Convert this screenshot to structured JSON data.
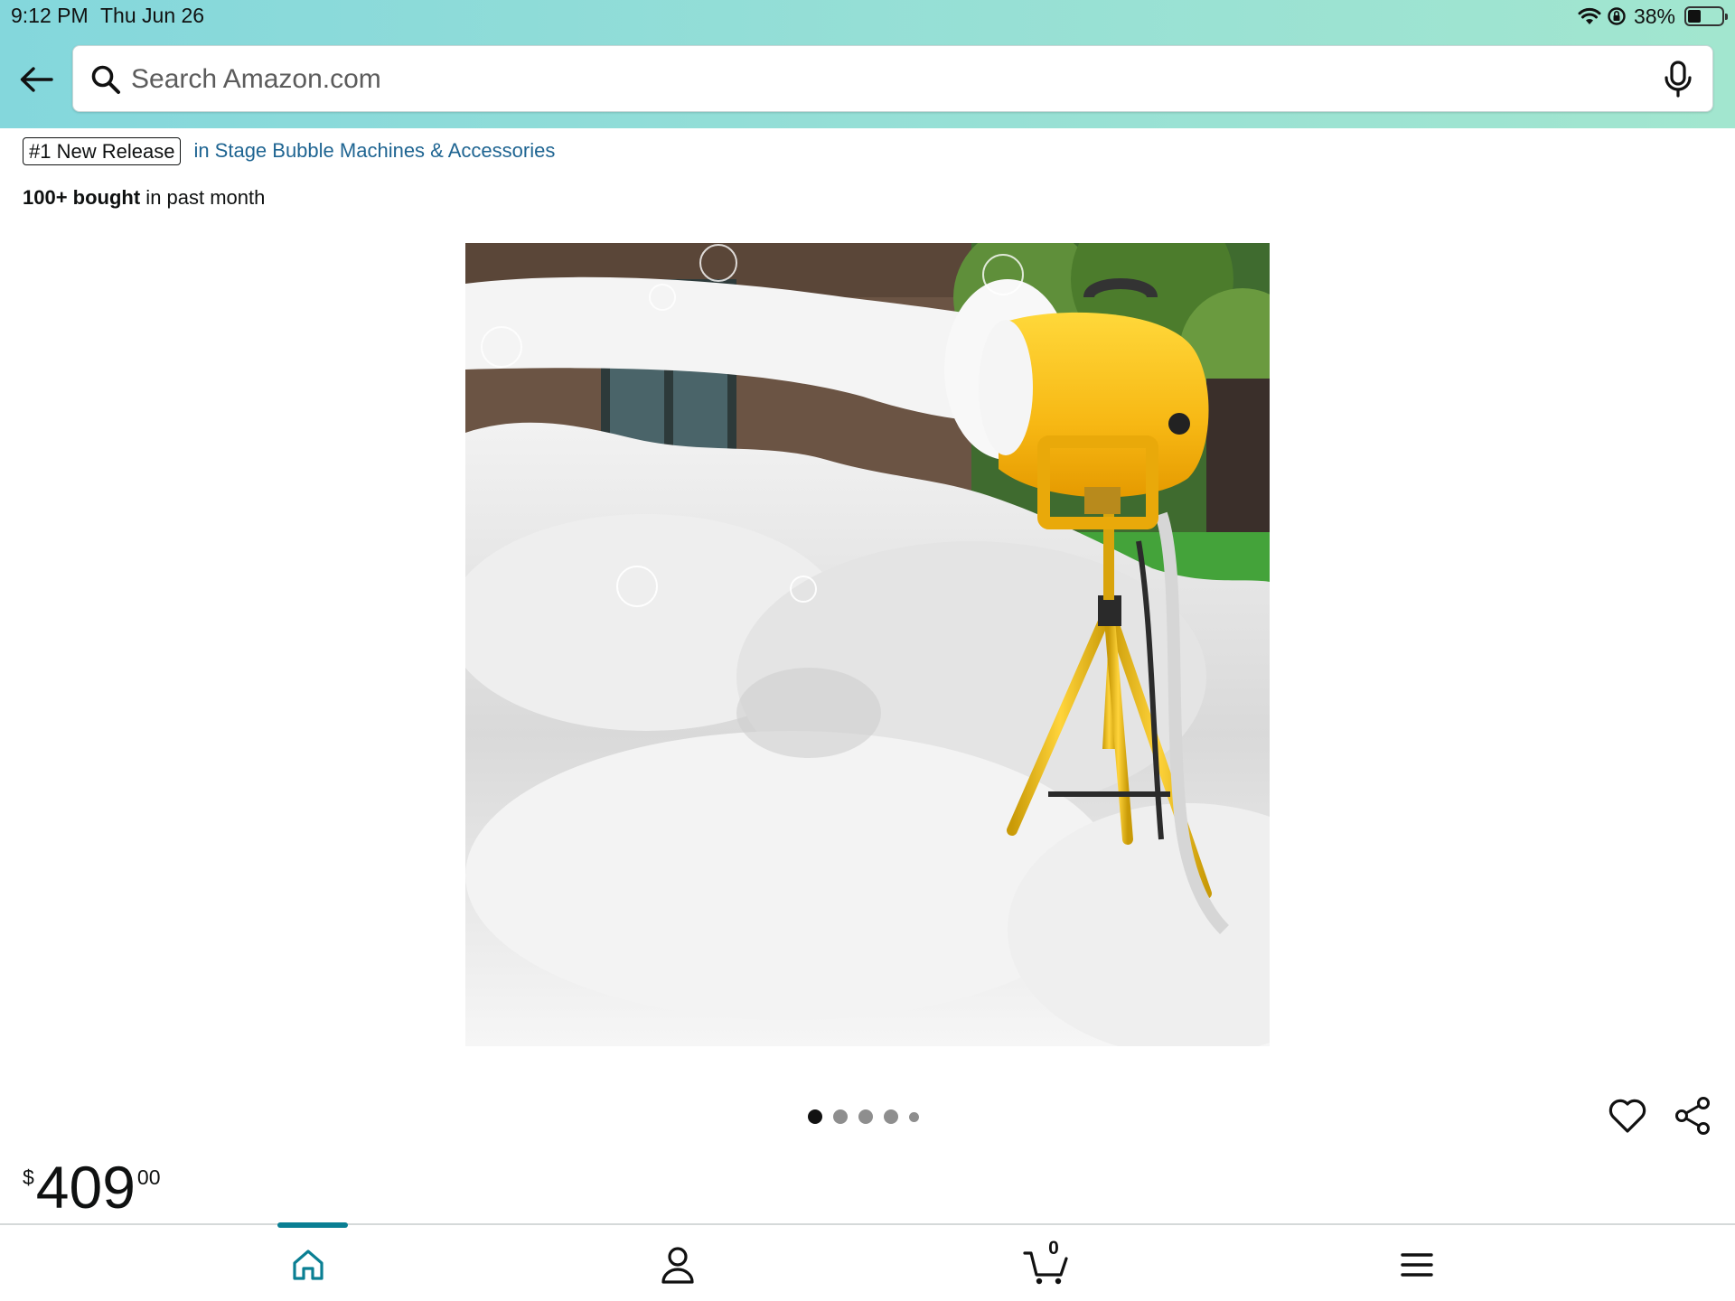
{
  "status_bar": {
    "time": "9:12 PM",
    "date": "Thu Jun 26",
    "battery_percent": "38%",
    "battery_level": 0.38,
    "icons": [
      "wifi-icon",
      "location-lock-icon",
      "battery-icon"
    ]
  },
  "header": {
    "back_icon": "arrow-left-icon",
    "search": {
      "placeholder": "Search Amazon.com",
      "value": "",
      "icon": "search-icon",
      "mic_icon": "microphone-icon"
    }
  },
  "product": {
    "badge": "#1 New Release",
    "category_link": "in Stage Bubble Machines & Accessories",
    "bought_bold": "100+ bought",
    "bought_rest": " in past month",
    "image_description_icon": "foam-machine-image",
    "carousel": {
      "total": 5,
      "active_index": 0
    },
    "actions": [
      "heart-icon",
      "share-icon"
    ],
    "price": {
      "symbol": "$",
      "whole": "409",
      "fraction": "00"
    }
  },
  "bottom_nav": {
    "items": [
      "home-icon",
      "account-icon",
      "cart-icon",
      "menu-icon"
    ],
    "active": "home",
    "cart_count": "0"
  },
  "colors": {
    "header_gradient_start": "#84d7dc",
    "header_gradient_end": "#a2e6cf",
    "link": "#1f6592",
    "nav_active": "#0a7f93",
    "product_yellow": "#f7c21a"
  }
}
